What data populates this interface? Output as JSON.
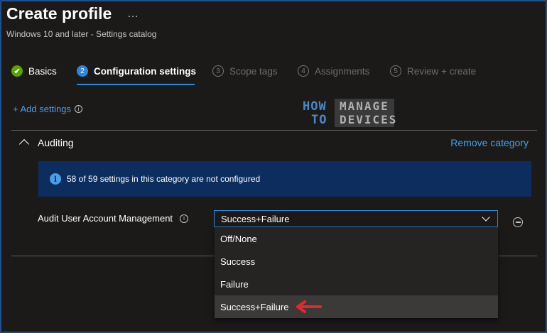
{
  "header": {
    "title": "Create profile",
    "more": "…",
    "subtitle": "Windows 10 and later - Settings catalog"
  },
  "wizard": {
    "steps": [
      {
        "number": "✔",
        "label": "Basics",
        "state": "completed"
      },
      {
        "number": "2",
        "label": "Configuration settings",
        "state": "active"
      },
      {
        "number": "3",
        "label": "Scope tags",
        "state": "pending"
      },
      {
        "number": "4",
        "label": "Assignments",
        "state": "pending"
      },
      {
        "number": "5",
        "label": "Review + create",
        "state": "pending"
      }
    ]
  },
  "toolbar": {
    "add_settings_label": "+ Add settings",
    "info_glyph": "i"
  },
  "watermark": {
    "line1_left": "HOW",
    "line1_right": "MANAGE",
    "line2_left": "TO",
    "line2_right": "DEVICES"
  },
  "category": {
    "title": "Auditing",
    "remove_label": "Remove category",
    "info_message": "58 of 59 settings in this category are not configured"
  },
  "setting": {
    "label": "Audit User Account Management",
    "selected_value": "Success+Failure",
    "options": [
      "Off/None",
      "Success",
      "Failure",
      "Success+Failure"
    ],
    "highlighted_option": "Success+Failure"
  },
  "colors": {
    "background": "#1b1a19",
    "accent": "#2b88d8",
    "link": "#4a9fe9",
    "completed": "#57a300",
    "info_bar": "#0c2d5e",
    "arrow": "#e8262b",
    "frame_border": "#1f4f8c"
  }
}
